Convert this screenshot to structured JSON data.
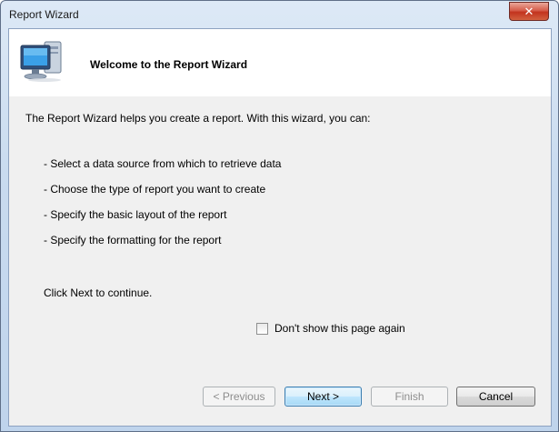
{
  "window": {
    "title": "Report Wizard",
    "close_glyph": "✕"
  },
  "header": {
    "icon": "computer-icon",
    "title": "Welcome to the Report Wizard"
  },
  "body": {
    "intro": "The Report Wizard helps you create a report. With this wizard, you can:",
    "bullets": [
      "- Select a data source from which to retrieve data",
      "- Choose the type of report you want to create",
      "- Specify the basic layout of the report",
      "- Specify the formatting for the report"
    ],
    "continue_text": "Click Next to continue.",
    "checkbox": {
      "label": "Don't show this page again",
      "checked": false
    }
  },
  "buttons": {
    "previous": "< Previous",
    "next": "Next >",
    "finish": "Finish",
    "cancel": "Cancel"
  },
  "colors": {
    "close_button": "#c2331e",
    "default_button_border": "#3c7fb1"
  }
}
